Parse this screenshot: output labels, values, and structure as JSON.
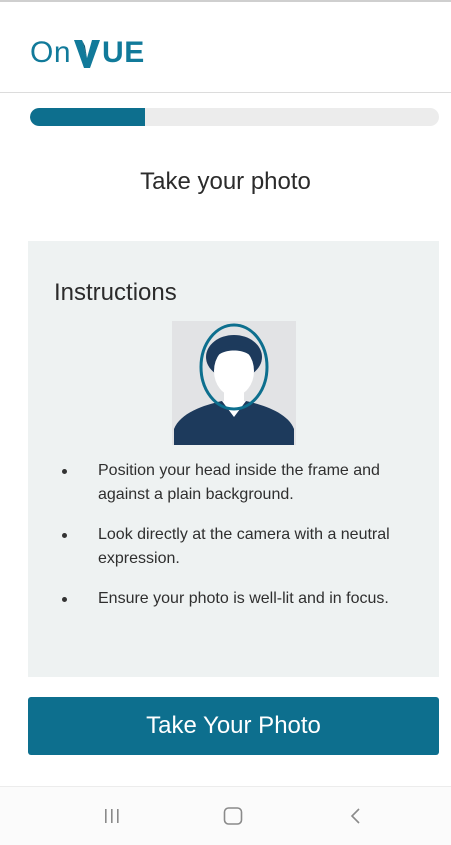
{
  "header": {
    "logo_text_on": "On",
    "logo_text_ue": "UE",
    "logo_alt": "OnVUE"
  },
  "progress": {
    "percent": 28
  },
  "page": {
    "title": "Take your photo"
  },
  "instructions": {
    "heading": "Instructions",
    "items": [
      "Position your head inside the frame and against a plain background.",
      "Look directly at the camera with a neutral expression.",
      "Ensure your photo is well-lit and in focus."
    ]
  },
  "actions": {
    "take_photo_label": "Take Your Photo"
  },
  "nav": {
    "recent_icon": "recent-apps-icon",
    "home_icon": "home-icon",
    "back_icon": "back-icon"
  },
  "colors": {
    "brand": "#117a9a",
    "primary": "#0d6f8e",
    "panel_bg": "#eef2f2",
    "avatar_dark": "#1d3a5c"
  }
}
